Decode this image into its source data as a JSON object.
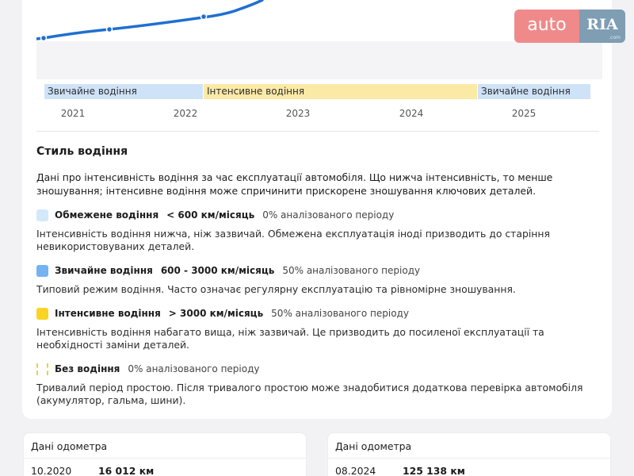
{
  "logo": {
    "auto": "auto",
    "ria": "RIA",
    "domain": ".com"
  },
  "chart_data": {
    "type": "line",
    "x_ticks": [
      "2021",
      "2022",
      "2023",
      "2024",
      "2025"
    ],
    "series": [
      {
        "values": []
      }
    ],
    "bands": [
      {
        "label": "Звичайне водіння",
        "style": "normal"
      },
      {
        "label": "Інтенсивне водіння",
        "style": "intense"
      },
      {
        "label": "Звичайне водіння",
        "style": "normal"
      }
    ],
    "line_color": "#1f6fd1"
  },
  "driving_style": {
    "title": "Стиль водіння",
    "intro": "Дані про інтенсивність водіння за час експлуатації автомобіля. Що нижча інтенсивність, то менше зношування; інтенсивне водіння може спричинити прискорене зношування ключових деталей.",
    "styles": [
      {
        "name": "Обмежене водіння",
        "range": "< 600 км/місяць",
        "share": "0% аналізованого періоду",
        "description": "Інтенсивність водіння нижча, ніж зазвичай. Обмежена експлуатація іноді призводить до старіння невикористовуваних деталей."
      },
      {
        "name": "Звичайне водіння",
        "range": "600 - 3000 км/місяць",
        "share": "50% аналізованого періоду",
        "description": "Типовий режим водіння. Часто означає регулярну експлуатацію та рівномірне зношування."
      },
      {
        "name": "Інтенсивне водіння",
        "range": "> 3000 км/місяць",
        "share": "50% аналізованого періоду",
        "description": "Інтенсивність водіння набагато вища, ніж зазвичай. Це призводить до посиленої експлуатації та необхідності заміни деталей."
      },
      {
        "name": "Без водіння",
        "range": "",
        "share": "0% аналізованого періоду",
        "description": "Тривалий період простою. Після тривалого простою може знадобитися додаткова перевірка автомобіля (акумулятор, гальма, шини)."
      }
    ]
  },
  "odometer_cards": [
    {
      "title": "Дані одометра",
      "date": "10.2020",
      "value": "16 012 км"
    },
    {
      "title": "Дані одометра",
      "date": "08.2024",
      "value": "125 138 км"
    }
  ]
}
